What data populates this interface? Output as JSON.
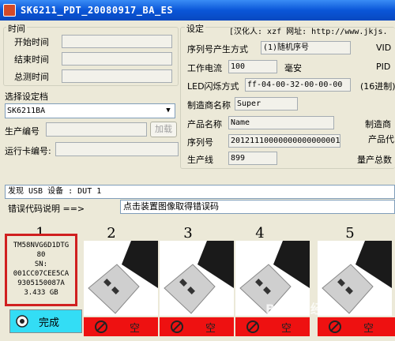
{
  "window": {
    "title": "SK6211_PDT_20080917_BA_ES"
  },
  "time_group": {
    "label": "时间",
    "fields": [
      {
        "label": "开始时间",
        "value": ""
      },
      {
        "label": "结束时间",
        "value": ""
      },
      {
        "label": "总测时间",
        "value": ""
      }
    ]
  },
  "config": {
    "select_label": "选择设定档",
    "selected": "SK6211BA",
    "serial_label": "生产编号",
    "serial_value": "",
    "add_button": "加载",
    "runcard_label": "运行卡编号:",
    "runcard_value": ""
  },
  "settings": {
    "label": "设定",
    "header_note": "[汉化人: xzf  网址: http://www.jkjs.",
    "rows": [
      {
        "label": "序列号产生方式",
        "value": "(1)随机序号",
        "extra": "VID"
      },
      {
        "label": "工作电流",
        "value": "100",
        "unit": "毫安",
        "extra": "PID"
      },
      {
        "label": "LED闪烁方式",
        "value": "ff-04-00-32-00-00-00",
        "extra": "(16进制)"
      },
      {
        "label": "制造商名称",
        "value": "Super"
      },
      {
        "label": "产品名称",
        "value": "Name",
        "extra": "制造商"
      },
      {
        "label": "序列号",
        "value": "20121110000000000000001",
        "extra": "产品代"
      },
      {
        "label": "生产线",
        "value": "899",
        "extra": "量产总数"
      }
    ]
  },
  "status": {
    "found_text": "发现 USB 设备 : DUT 1",
    "error_label": "错误代码说明 ==>",
    "error_text": "点击装置图像取得错误码"
  },
  "slots": [
    {
      "number": "1",
      "info": [
        "TM58NVG6D1DTG",
        "80",
        "SN:",
        "001CC07CEE5CA",
        "9305150087A",
        "3.433 GB"
      ],
      "status": "完成"
    },
    {
      "number": "2",
      "status": "空"
    },
    {
      "number": "3",
      "status": "空"
    },
    {
      "number": "4",
      "status": "空"
    },
    {
      "number": "5",
      "status": "空"
    }
  ],
  "colors": {
    "title_bar": "#0A56D8",
    "window_bg": "#ECE9D8",
    "slot_done": "#33DDF5",
    "slot_empty": "#EE1111",
    "selected_border": "#D02020"
  },
  "watermark": "Baidu 经验"
}
